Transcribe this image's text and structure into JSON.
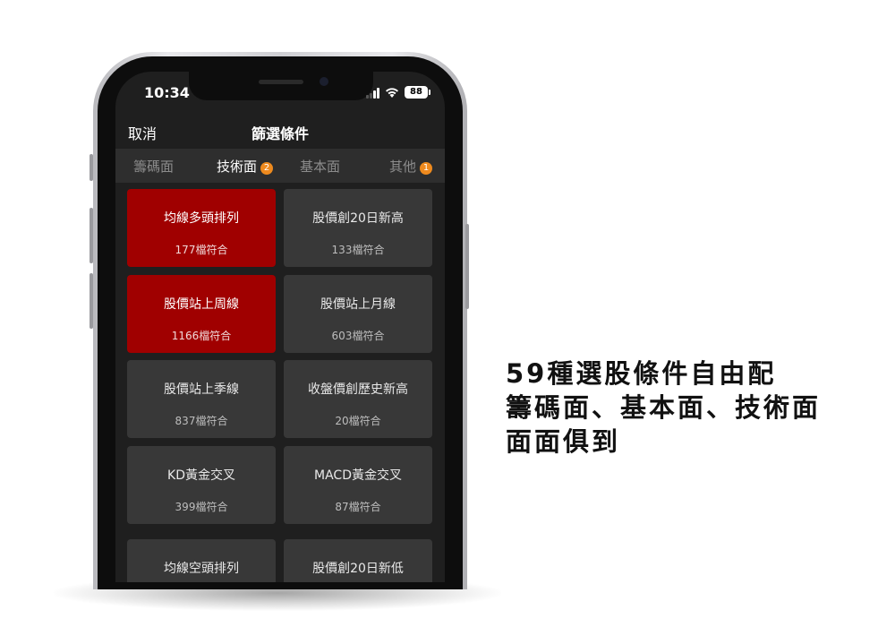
{
  "status_bar": {
    "time": "10:34",
    "battery": "88"
  },
  "header": {
    "cancel_label": "取消",
    "title": "篩選條件"
  },
  "tabs": [
    {
      "label": "籌碼面",
      "active": false,
      "badge": ""
    },
    {
      "label": "技術面",
      "active": true,
      "badge": "2"
    },
    {
      "label": "基本面",
      "active": false,
      "badge": ""
    },
    {
      "label": "其他",
      "active": false,
      "badge": "1"
    }
  ],
  "conditions": [
    {
      "name": "均線多頭排列",
      "count": "177檔符合",
      "selected": true
    },
    {
      "name": "股價創20日新高",
      "count": "133檔符合",
      "selected": false
    },
    {
      "name": "股價站上周線",
      "count": "1166檔符合",
      "selected": true
    },
    {
      "name": "股價站上月線",
      "count": "603檔符合",
      "selected": false
    },
    {
      "name": "股價站上季線",
      "count": "837檔符合",
      "selected": false
    },
    {
      "name": "收盤價創歷史新高",
      "count": "20檔符合",
      "selected": false
    },
    {
      "name": "KD黃金交叉",
      "count": "399檔符合",
      "selected": false
    },
    {
      "name": "MACD黃金交叉",
      "count": "87檔符合",
      "selected": false
    },
    {
      "name": "均線空頭排列",
      "count": "",
      "selected": false
    },
    {
      "name": "股價創20日新低",
      "count": "",
      "selected": false
    }
  ],
  "promo": {
    "lines": [
      "59種選股條件自由配",
      "籌碼面、基本面、技術面",
      "面面俱到"
    ]
  },
  "colors": {
    "selected_card": "#a00000",
    "card": "#383838",
    "badge": "#ee8a1e",
    "screen_bg": "#1f1f1f"
  }
}
